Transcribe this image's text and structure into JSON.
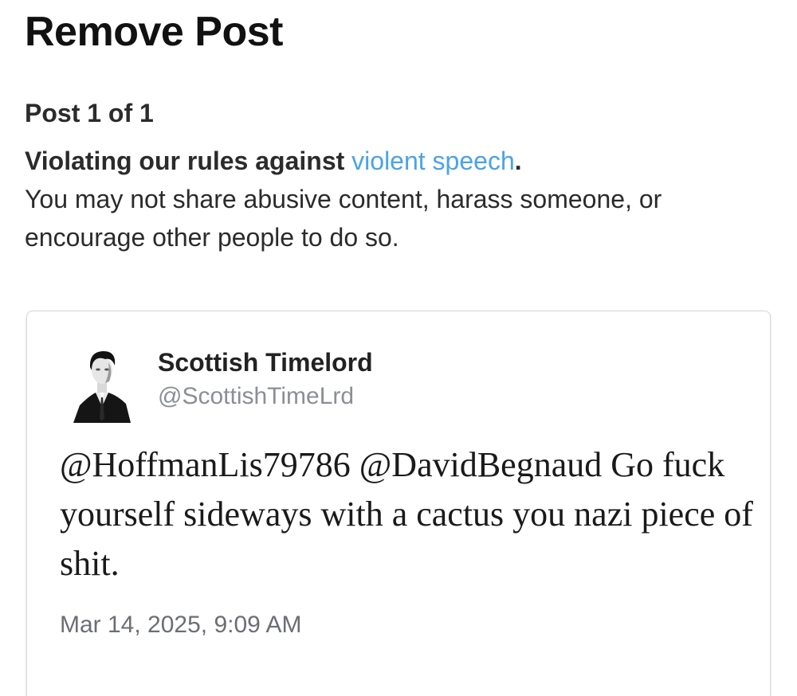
{
  "page": {
    "title": "Remove Post"
  },
  "post_counter": "Post 1 of 1",
  "violation": {
    "lead": "Violating our rules against ",
    "rule_link": "violent speech",
    "period": ".",
    "explanation": "You may not share abusive content, harass someone, or encourage other people to do so."
  },
  "colors": {
    "link": "#4aa3e8",
    "handle": "#8a8f94",
    "timestamp": "#6b6e72"
  },
  "post": {
    "author_name": "Scottish Timelord",
    "author_handle": "@ScottishTimeLrd",
    "avatar_icon": "profile-photo",
    "text": "@HoffmanLis79786 @DavidBegnaud Go fuck yourself sideways with a cactus you nazi piece of shit.",
    "timestamp": "Mar 14, 2025, 9:09 AM"
  }
}
